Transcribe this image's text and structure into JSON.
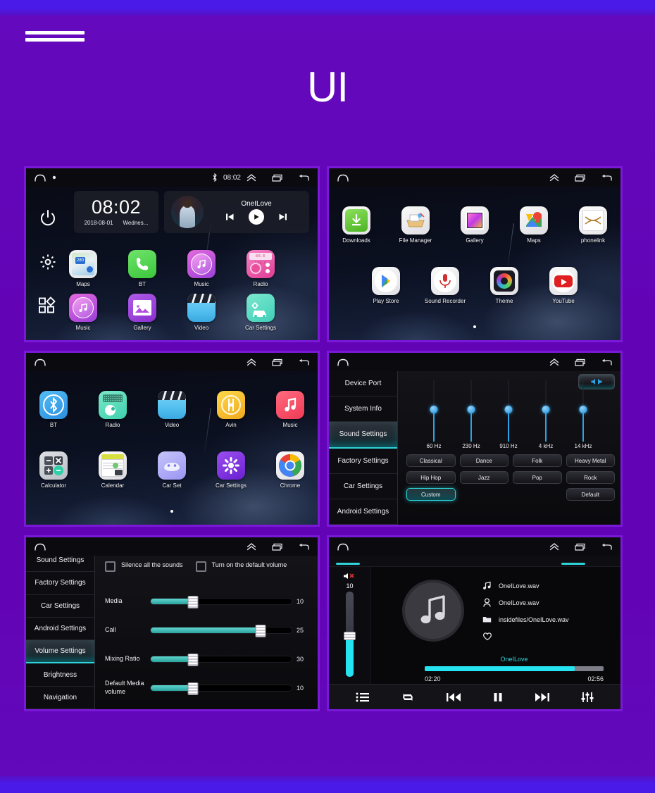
{
  "page": {
    "title": "UI",
    "menu_icon": "hamburger-icon",
    "bg_color": "#6204b6",
    "accent_color": "#7a18d8"
  },
  "panels": {
    "home": {
      "statusbar": {
        "home_icon": "home-icon",
        "dot_icon": "dot-icon",
        "bluetooth_icon": "bluetooth-icon",
        "time": "08:02",
        "up_icon": "chevron-up-icon",
        "recents_icon": "recents-icon",
        "back_icon": "back-icon"
      },
      "rail": [
        {
          "name": "power-icon",
          "label": "Power"
        },
        {
          "name": "gear-icon",
          "label": "Settings"
        },
        {
          "name": "apps-grid-icon",
          "label": "Apps"
        }
      ],
      "clock_widget": {
        "time": "08:02",
        "date": "2018-08-01",
        "weekday": "Wednes..."
      },
      "media_widget": {
        "title": "OneILove",
        "prev_icon": "skip-previous-icon",
        "play_icon": "play-icon",
        "next_icon": "skip-next-icon"
      },
      "apps_row1": [
        {
          "label": "Maps",
          "icon": "maps-icon"
        },
        {
          "label": "BT",
          "icon": "phone-icon"
        },
        {
          "label": "Music",
          "icon": "music-icon"
        },
        {
          "label": "Radio",
          "icon": "radio-icon"
        }
      ],
      "apps_row2": [
        {
          "label": "Music",
          "icon": "music-icon"
        },
        {
          "label": "Gallery",
          "icon": "gallery-icon"
        },
        {
          "label": "Video",
          "icon": "video-icon"
        },
        {
          "label": "Car Settings",
          "icon": "car-settings-icon"
        }
      ]
    },
    "drawer1": {
      "statusbar": {
        "home_icon": "home-icon",
        "up_icon": "chevron-up-icon",
        "recents_icon": "recents-icon",
        "back_icon": "back-icon"
      },
      "apps_row1": [
        {
          "label": "Downloads",
          "icon": "downloads-icon"
        },
        {
          "label": "File Manager",
          "icon": "file-manager-icon"
        },
        {
          "label": "Gallery",
          "icon": "gallery-icon"
        },
        {
          "label": "Maps",
          "icon": "google-maps-icon"
        },
        {
          "label": "phonelink",
          "icon": "phonelink-icon"
        }
      ],
      "apps_row2": [
        {
          "label": "Play Store",
          "icon": "play-store-icon"
        },
        {
          "label": "Sound Recorder",
          "icon": "sound-recorder-icon"
        },
        {
          "label": "Theme",
          "icon": "theme-icon"
        },
        {
          "label": "YouTube",
          "icon": "youtube-icon"
        }
      ]
    },
    "drawer2": {
      "statusbar": {
        "home_icon": "home-icon",
        "up_icon": "chevron-up-icon",
        "recents_icon": "recents-icon",
        "back_icon": "back-icon"
      },
      "apps_row1": [
        {
          "label": "BT",
          "icon": "bluetooth-icon"
        },
        {
          "label": "Radio",
          "icon": "radio-icon"
        },
        {
          "label": "Video",
          "icon": "video-icon"
        },
        {
          "label": "Avin",
          "icon": "avin-icon"
        },
        {
          "label": "Music",
          "icon": "music-icon"
        }
      ],
      "apps_row2": [
        {
          "label": "Calculator",
          "icon": "calculator-icon"
        },
        {
          "label": "Calendar",
          "icon": "calendar-icon"
        },
        {
          "label": "Car Set",
          "icon": "car-set-icon"
        },
        {
          "label": "Car Settings",
          "icon": "car-settings-icon"
        },
        {
          "label": "Chrome",
          "icon": "chrome-icon"
        }
      ]
    },
    "sound_settings": {
      "statusbar": {
        "home_icon": "home-icon",
        "up_icon": "chevron-up-icon",
        "recents_icon": "recents-icon",
        "back_icon": "back-icon"
      },
      "sidebar": [
        {
          "label": "Device Port",
          "active": false
        },
        {
          "label": "System Info",
          "active": false
        },
        {
          "label": "Sound Settings",
          "active": true
        },
        {
          "label": "Factory Settings",
          "active": false
        },
        {
          "label": "Car Settings",
          "active": false
        },
        {
          "label": "Android Settings",
          "active": false
        }
      ],
      "speaker_icon": "balance-speaker-icon",
      "equalizer": {
        "bands": [
          {
            "label": "60 Hz",
            "value": 50
          },
          {
            "label": "230 Hz",
            "value": 50
          },
          {
            "label": "910 Hz",
            "value": 50
          },
          {
            "label": "4 kHz",
            "value": 50
          },
          {
            "label": "14 kHz",
            "value": 50
          }
        ]
      },
      "presets": [
        {
          "label": "Classical",
          "selected": false
        },
        {
          "label": "Dance",
          "selected": false
        },
        {
          "label": "Folk",
          "selected": false
        },
        {
          "label": "Heavy Metal",
          "selected": false
        },
        {
          "label": "Hip Hop",
          "selected": false
        },
        {
          "label": "Jazz",
          "selected": false
        },
        {
          "label": "Pop",
          "selected": false
        },
        {
          "label": "Rock",
          "selected": false
        },
        {
          "label": "Custom",
          "selected": true
        },
        {
          "label": "",
          "selected": false
        },
        {
          "label": "",
          "selected": false
        },
        {
          "label": "Default",
          "selected": false
        }
      ]
    },
    "volume_settings": {
      "statusbar": {
        "home_icon": "home-icon",
        "up_icon": "chevron-up-icon",
        "recents_icon": "recents-icon",
        "back_icon": "back-icon"
      },
      "sidebar": [
        {
          "label": "Sound Settings",
          "active": false
        },
        {
          "label": "Factory Settings",
          "active": false
        },
        {
          "label": "Car Settings",
          "active": false
        },
        {
          "label": "Android Settings",
          "active": false
        },
        {
          "label": "Volume Settings",
          "active": true
        },
        {
          "label": "Brightness",
          "active": false
        },
        {
          "label": "Navigation",
          "active": false
        }
      ],
      "checkboxes": [
        {
          "label": "Silence all the sounds",
          "checked": false
        },
        {
          "label": "Turn on the default volume",
          "checked": false
        }
      ],
      "sliders": [
        {
          "label": "Media",
          "value": "10",
          "percent": 30
        },
        {
          "label": "Call",
          "value": "25",
          "percent": 78
        },
        {
          "label": "Mixing Ratio",
          "value": "30",
          "percent": 30
        },
        {
          "label": "Default Media volume",
          "value": "10",
          "percent": 30
        }
      ]
    },
    "music_player": {
      "statusbar": {
        "home_icon": "home-icon",
        "up_icon": "chevron-up-icon",
        "recents_icon": "recents-icon",
        "back_icon": "back-icon"
      },
      "volume": {
        "mute_icon": "volume-mute-icon",
        "value": "10",
        "percent": 48
      },
      "cover_icon": "music-note-icon",
      "meta": [
        {
          "icon": "music-note-icon",
          "text": "OneILove.wav"
        },
        {
          "icon": "person-icon",
          "text": "OneILove.wav"
        },
        {
          "icon": "folder-icon",
          "text": "insidefiles/OneILove.wav"
        },
        {
          "icon": "heart-icon",
          "text": ""
        }
      ],
      "track_title": "OneILove",
      "elapsed": "02:20",
      "duration": "02:56",
      "progress_percent": 84,
      "controls": [
        {
          "name": "playlist-icon"
        },
        {
          "name": "repeat-icon"
        },
        {
          "name": "skip-previous-icon"
        },
        {
          "name": "pause-icon"
        },
        {
          "name": "skip-next-icon"
        },
        {
          "name": "equalizer-icon"
        }
      ]
    }
  }
}
